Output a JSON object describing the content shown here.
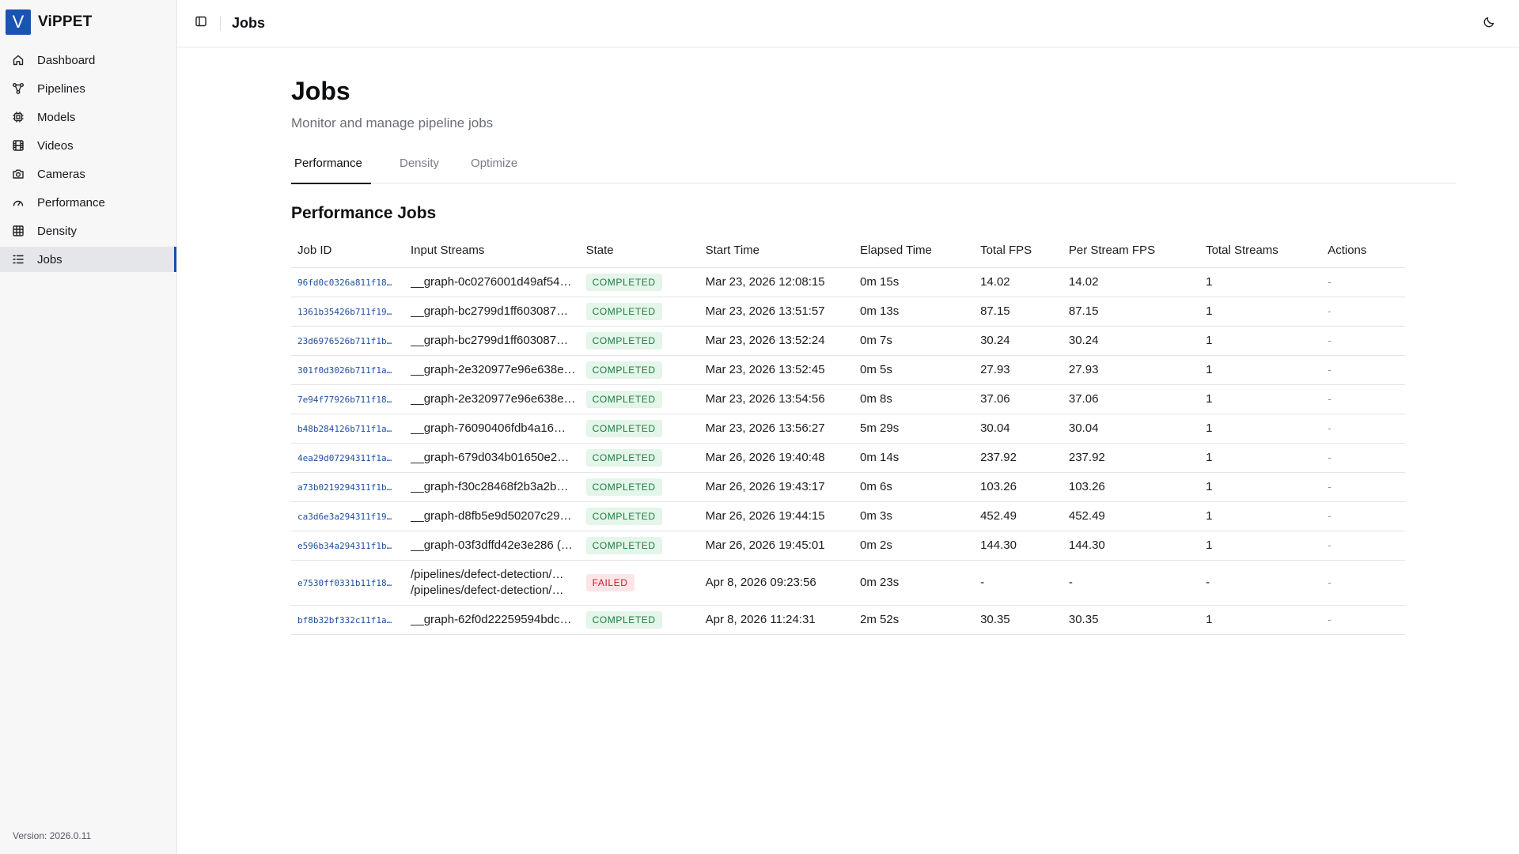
{
  "app": {
    "logo_letter": "V",
    "name": "ViPPET",
    "version": "Version: 2026.0.11"
  },
  "sidebar": {
    "items": [
      {
        "label": "Dashboard",
        "icon": "home-icon"
      },
      {
        "label": "Pipelines",
        "icon": "pipeline-icon"
      },
      {
        "label": "Models",
        "icon": "chip-icon"
      },
      {
        "label": "Videos",
        "icon": "film-icon"
      },
      {
        "label": "Cameras",
        "icon": "camera-icon"
      },
      {
        "label": "Performance",
        "icon": "gauge-icon"
      },
      {
        "label": "Density",
        "icon": "grid-icon"
      },
      {
        "label": "Jobs",
        "icon": "list-icon",
        "active": true
      }
    ]
  },
  "topbar": {
    "title": "Jobs"
  },
  "page": {
    "title": "Jobs",
    "subtitle": "Monitor and manage pipeline jobs"
  },
  "tabs": [
    {
      "label": "Performance",
      "active": true
    },
    {
      "label": "Density"
    },
    {
      "label": "Optimize"
    }
  ],
  "section": {
    "title": "Performance Jobs"
  },
  "table": {
    "headers": [
      "Job ID",
      "Input Streams",
      "State",
      "Start Time",
      "Elapsed Time",
      "Total FPS",
      "Per Stream FPS",
      "Total Streams",
      "Actions"
    ],
    "rows": [
      {
        "job_id": "96fd0c0326a811f18…",
        "input": [
          "__graph-0c0276001d49af54…"
        ],
        "state": "COMPLETED",
        "start": "Mar 23, 2026 12:08:15",
        "elapsed": "0m 15s",
        "total_fps": "14.02",
        "per_stream_fps": "14.02",
        "total_streams": "1",
        "actions": "-"
      },
      {
        "job_id": "1361b35426b711f19…",
        "input": [
          "__graph-bc2799d1ff603087…"
        ],
        "state": "COMPLETED",
        "start": "Mar 23, 2026 13:51:57",
        "elapsed": "0m 13s",
        "total_fps": "87.15",
        "per_stream_fps": "87.15",
        "total_streams": "1",
        "actions": "-"
      },
      {
        "job_id": "23d6976526b711f1b…",
        "input": [
          "__graph-bc2799d1ff603087…"
        ],
        "state": "COMPLETED",
        "start": "Mar 23, 2026 13:52:24",
        "elapsed": "0m 7s",
        "total_fps": "30.24",
        "per_stream_fps": "30.24",
        "total_streams": "1",
        "actions": "-"
      },
      {
        "job_id": "301f0d3026b711f1a…",
        "input": [
          "__graph-2e320977e96e638e…"
        ],
        "state": "COMPLETED",
        "start": "Mar 23, 2026 13:52:45",
        "elapsed": "0m 5s",
        "total_fps": "27.93",
        "per_stream_fps": "27.93",
        "total_streams": "1",
        "actions": "-"
      },
      {
        "job_id": "7e94f77926b711f18…",
        "input": [
          "__graph-2e320977e96e638e…"
        ],
        "state": "COMPLETED",
        "start": "Mar 23, 2026 13:54:56",
        "elapsed": "0m 8s",
        "total_fps": "37.06",
        "per_stream_fps": "37.06",
        "total_streams": "1",
        "actions": "-"
      },
      {
        "job_id": "b48b284126b711f1a…",
        "input": [
          "__graph-76090406fdb4a16…"
        ],
        "state": "COMPLETED",
        "start": "Mar 23, 2026 13:56:27",
        "elapsed": "5m 29s",
        "total_fps": "30.04",
        "per_stream_fps": "30.04",
        "total_streams": "1",
        "actions": "-"
      },
      {
        "job_id": "4ea29d07294311f1a…",
        "input": [
          "__graph-679d034b01650e2…"
        ],
        "state": "COMPLETED",
        "start": "Mar 26, 2026 19:40:48",
        "elapsed": "0m 14s",
        "total_fps": "237.92",
        "per_stream_fps": "237.92",
        "total_streams": "1",
        "actions": "-"
      },
      {
        "job_id": "a73b0219294311f1b…",
        "input": [
          "__graph-f30c28468f2b3a2b…"
        ],
        "state": "COMPLETED",
        "start": "Mar 26, 2026 19:43:17",
        "elapsed": "0m 6s",
        "total_fps": "103.26",
        "per_stream_fps": "103.26",
        "total_streams": "1",
        "actions": "-"
      },
      {
        "job_id": "ca3d6e3a294311f19…",
        "input": [
          "__graph-d8fb5e9d50207c29…"
        ],
        "state": "COMPLETED",
        "start": "Mar 26, 2026 19:44:15",
        "elapsed": "0m 3s",
        "total_fps": "452.49",
        "per_stream_fps": "452.49",
        "total_streams": "1",
        "actions": "-"
      },
      {
        "job_id": "e596b34a294311f1b…",
        "input": [
          "__graph-03f3dffd42e3e286 (…"
        ],
        "state": "COMPLETED",
        "start": "Mar 26, 2026 19:45:01",
        "elapsed": "0m 2s",
        "total_fps": "144.30",
        "per_stream_fps": "144.30",
        "total_streams": "1",
        "actions": "-"
      },
      {
        "job_id": "e7530ff0331b11f18…",
        "input": [
          "/pipelines/defect-detection/…",
          "/pipelines/defect-detection/…"
        ],
        "state": "FAILED",
        "start": "Apr 8, 2026 09:23:56",
        "elapsed": "0m 23s",
        "total_fps": "-",
        "per_stream_fps": "-",
        "total_streams": "-",
        "actions": "-"
      },
      {
        "job_id": "bf8b32bf332c11f1a…",
        "input": [
          "__graph-62f0d22259594bdc…"
        ],
        "state": "COMPLETED",
        "start": "Apr 8, 2026 11:24:31",
        "elapsed": "2m 52s",
        "total_fps": "30.35",
        "per_stream_fps": "30.35",
        "total_streams": "1",
        "actions": "-"
      }
    ]
  },
  "colors": {
    "accent": "#1954b2",
    "completed_bg": "#e4f5e9",
    "completed_fg": "#1f7a43",
    "failed_bg": "#fde5e7",
    "failed_fg": "#c4202e"
  }
}
